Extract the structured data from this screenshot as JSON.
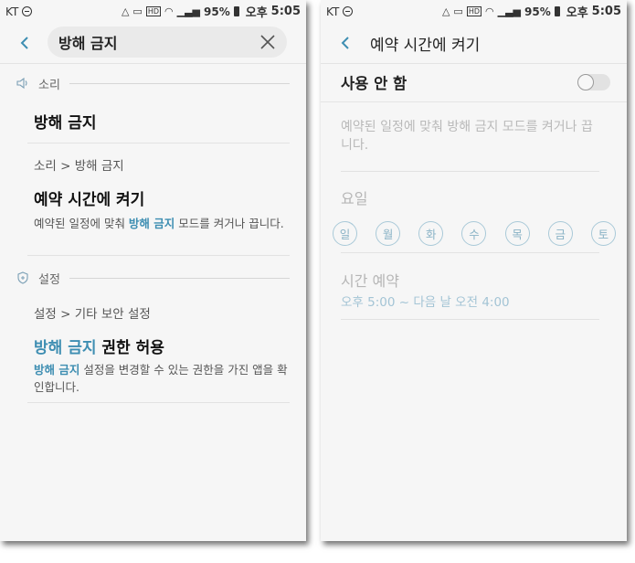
{
  "statusbar": {
    "carrier": "KT",
    "battery": "95%",
    "ampm": "오후",
    "time": "5:05"
  },
  "left": {
    "search": {
      "value": "방해 금지"
    },
    "sections": [
      {
        "header": "소리",
        "header_icon": "speaker-icon",
        "items": [
          {
            "title": "방해 금지"
          },
          {
            "breadcrumb": "소리 > 방해 금지"
          },
          {
            "title": "예약 시간에 켜기",
            "desc_before": "예약된 일정에 맞춰 ",
            "desc_highlight": "방해 금지",
            "desc_after": " 모드를 켜거나 끕니다."
          }
        ]
      },
      {
        "header": "설정",
        "header_icon": "shield-icon",
        "items": [
          {
            "breadcrumb": "설정 > 기타 보안 설정"
          },
          {
            "title_highlight": "방해 금지",
            "title_rest": " 권한 허용",
            "desc_highlight": "방해 금지",
            "desc_after": " 설정을 변경할 수 있는 권한을 가진 앱을 확인합니다."
          }
        ]
      }
    ]
  },
  "right": {
    "header_title": "예약 시간에 켜기",
    "toggle_label": "사용 안 함",
    "toggle_on": false,
    "description": "예약된 일정에 맞춰 방해 금지 모드를 켜거나 끕니다.",
    "days_label": "요일",
    "days": [
      "일",
      "월",
      "화",
      "수",
      "목",
      "금",
      "토"
    ],
    "schedule_label": "시간 예약",
    "schedule_value": "오후 5:00 ~ 다음 날 오전 4:00"
  },
  "colors": {
    "accent": "#3e8eb2",
    "screen_bg": "#f6f6f6",
    "disabled_text": "#b9b9b9"
  }
}
